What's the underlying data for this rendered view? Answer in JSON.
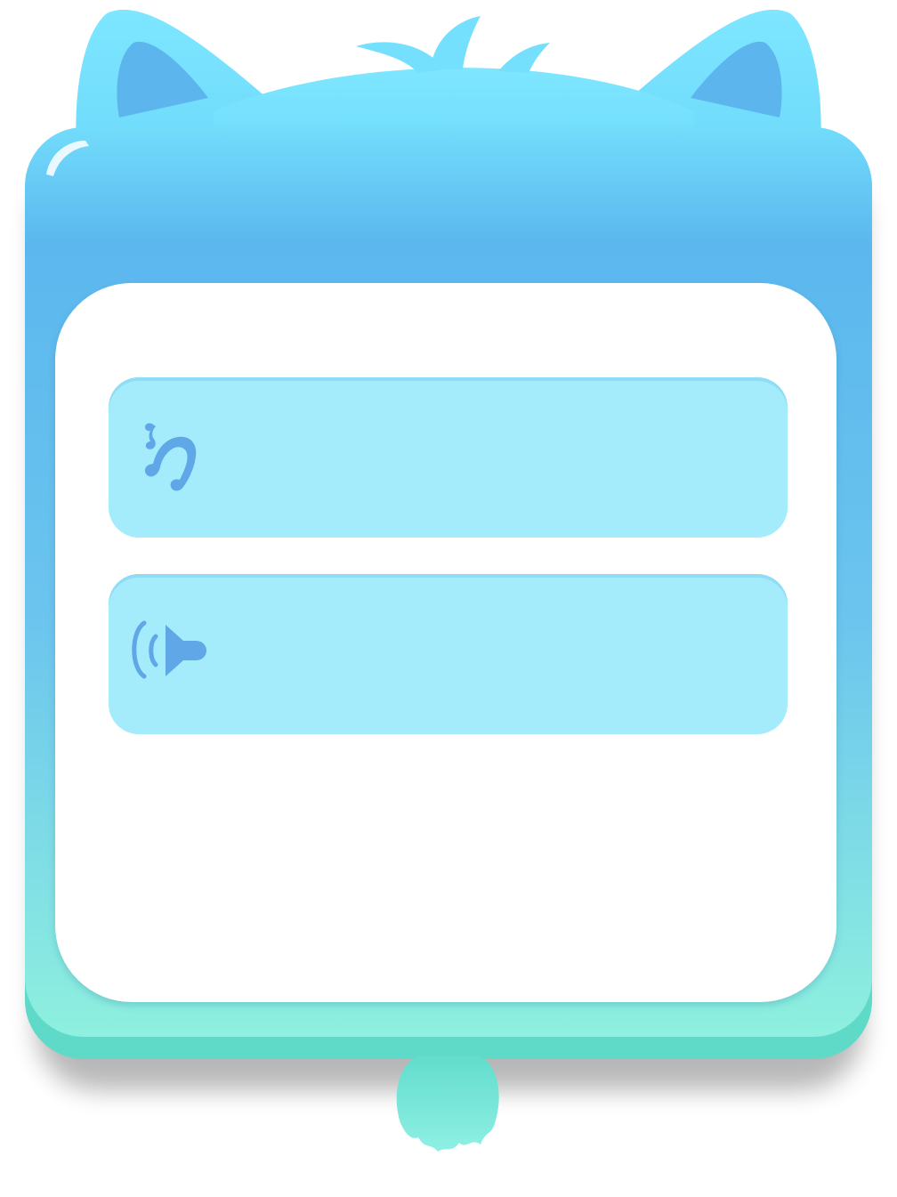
{
  "settings_panel": {
    "rows": [
      {
        "id": "music",
        "icon": "music-note-icon",
        "label": ""
      },
      {
        "id": "sound",
        "icon": "speaker-sound-icon",
        "label": ""
      }
    ]
  },
  "colors": {
    "frame_top": "#74e1fd",
    "frame_mid": "#5db8ee",
    "frame_bottom": "#8ee9de",
    "base_teal": "#5fd9c8",
    "ear_inner": "#5cb6ed",
    "row_fill": "#a4ebfc",
    "icon_fill": "#5fa7e6",
    "panel_white": "#ffffff"
  }
}
